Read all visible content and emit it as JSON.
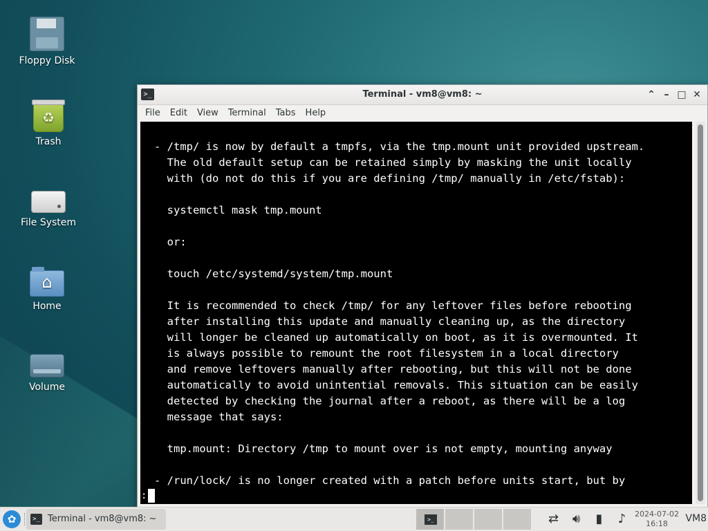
{
  "desktop": {
    "icons": [
      {
        "label": "Floppy Disk",
        "icon": "floppy-disk-icon"
      },
      {
        "label": "Trash",
        "icon": "trash-icon"
      },
      {
        "label": "File System",
        "icon": "drive-icon"
      },
      {
        "label": "Home",
        "icon": "home-folder-icon"
      },
      {
        "label": "Volume",
        "icon": "volume-drive-icon"
      }
    ]
  },
  "window": {
    "title": "Terminal - vm8@vm8: ~",
    "app_icon_glyph": ">_",
    "buttons": {
      "shade": "⌃",
      "minimize": "–",
      "maximize": "□",
      "close": "✕"
    },
    "menu": [
      "File",
      "Edit",
      "View",
      "Terminal",
      "Tabs",
      "Help"
    ]
  },
  "terminal": {
    "lines": [
      "- /tmp/ is now by default a tmpfs, via the tmp.mount unit provided upstream.",
      "  The old default setup can be retained simply by masking the unit locally",
      "  with (do not do this if you are defining /tmp/ manually in /etc/fstab):",
      "",
      "  systemctl mask tmp.mount",
      "",
      "  or:",
      "",
      "  touch /etc/systemd/system/tmp.mount",
      "",
      "  It is recommended to check /tmp/ for any leftover files before rebooting",
      "  after installing this update and manually cleaning up, as the directory",
      "  will longer be cleaned up automatically on boot, as it is overmounted. It",
      "  is always possible to remount the root filesystem in a local directory",
      "  and remove leftovers manually after rebooting, but this will not be done",
      "  automatically to avoid unintential removals. This situation can be easily",
      "  detected by checking the journal after a reboot, as there will be a log",
      "  message that says:",
      "",
      "  tmp.mount: Directory /tmp to mount over is not empty, mounting anyway",
      "",
      "- /run/lock/ is no longer created with a patch before units start, but by"
    ],
    "prompt": ":"
  },
  "taskbar": {
    "task_label": "Terminal - vm8@vm8: ~",
    "tray_icons": [
      "network-icon",
      "volume-icon",
      "battery-icon",
      "notification-bell-icon"
    ],
    "clock_date": "2024-07-02",
    "clock_time": "16:18",
    "user": "VM8"
  },
  "colors": {
    "terminal_bg": "#000000",
    "terminal_fg": "#ffffff",
    "desktop_bg": "#1f6a73",
    "menu_button": "#2d8bd6"
  }
}
